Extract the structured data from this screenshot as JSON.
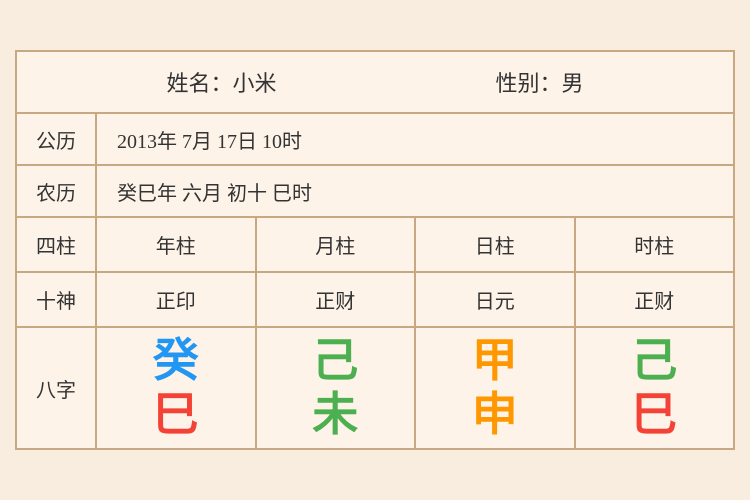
{
  "header": {
    "name_label": "姓名：小米",
    "gender_label": "性别：男"
  },
  "gregorian": {
    "label": "公历",
    "value": "2013年 7月 17日 10时"
  },
  "lunar": {
    "label": "农历",
    "value": "癸巳年 六月 初十 巳时"
  },
  "pillars": {
    "label": "四柱",
    "columns": [
      "年柱",
      "月柱",
      "日柱",
      "时柱"
    ]
  },
  "shishen": {
    "label": "十神",
    "columns": [
      "正印",
      "正财",
      "日元",
      "正财"
    ]
  },
  "bazi": {
    "label": "八字",
    "columns": [
      {
        "top": "癸",
        "top_color": "color-blue",
        "bottom": "巳",
        "bottom_color": "color-red"
      },
      {
        "top": "己",
        "top_color": "color-green",
        "bottom": "未",
        "bottom_color": "color-green"
      },
      {
        "top": "甲",
        "top_color": "color-orange",
        "bottom": "申",
        "bottom_color": "color-orange"
      },
      {
        "top": "己",
        "top_color": "color-green2",
        "bottom": "巳",
        "bottom_color": "color-red"
      }
    ]
  }
}
